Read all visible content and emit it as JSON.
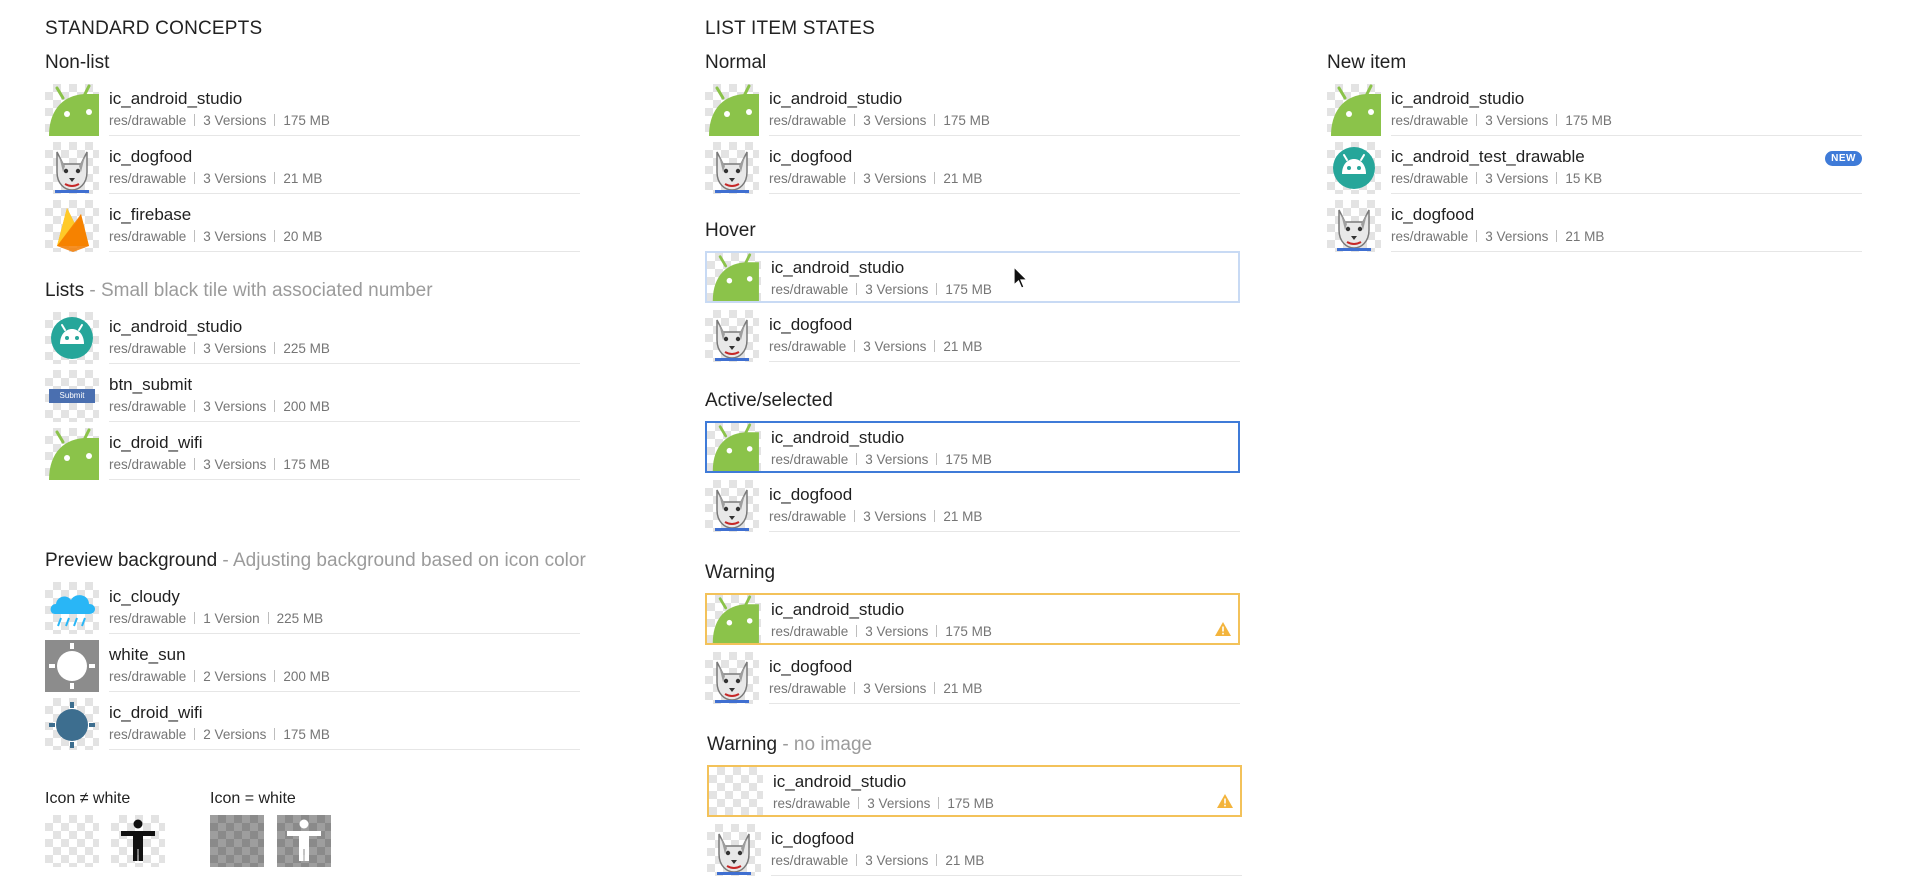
{
  "titles": {
    "standard": "STANDARD CONCEPTS",
    "list_states": "LIST ITEM STATES"
  },
  "sections": {
    "non_list": "Non-list",
    "lists": "Lists",
    "lists_sub": " - Small black tile with associated number",
    "preview": "Preview background",
    "preview_sub": " - Adjusting background based on icon color",
    "normal": "Normal",
    "hover": "Hover",
    "active": "Active/selected",
    "warning": "Warning",
    "warning_noimg": "Warning",
    "warning_noimg_sub": " - no image",
    "new_item": "New item",
    "icon_ne_white": "Icon ≠ white",
    "icon_eq_white": "Icon = white"
  },
  "rows": {
    "nl1": {
      "name": "ic_android_studio",
      "path": "res/drawable",
      "versions": "3 Versions",
      "size": "175 MB"
    },
    "nl2": {
      "name": "ic_dogfood",
      "path": "res/drawable",
      "versions": "3 Versions",
      "size": "21 MB"
    },
    "nl3": {
      "name": "ic_firebase",
      "path": "res/drawable",
      "versions": "3 Versions",
      "size": "20 MB"
    },
    "li1": {
      "name": "ic_android_studio",
      "path": "res/drawable",
      "versions": "3 Versions",
      "size": "225 MB"
    },
    "li2": {
      "name": "btn_submit",
      "path": "res/drawable",
      "versions": "3 Versions",
      "size": "200 MB",
      "thumb_text": "Submit"
    },
    "li3": {
      "name": "ic_droid_wifi",
      "path": "res/drawable",
      "versions": "3 Versions",
      "size": "175 MB"
    },
    "pb1": {
      "name": "ic_cloudy",
      "path": "res/drawable",
      "versions": "1 Version",
      "size": "225 MB"
    },
    "pb2": {
      "name": "white_sun",
      "path": "res/drawable",
      "versions": "2 Versions",
      "size": "200 MB"
    },
    "pb3": {
      "name": "ic_droid_wifi",
      "path": "res/drawable",
      "versions": "2 Versions",
      "size": "175 MB"
    },
    "n1": {
      "name": "ic_android_studio",
      "path": "res/drawable",
      "versions": "3 Versions",
      "size": "175 MB"
    },
    "n2": {
      "name": "ic_dogfood",
      "path": "res/drawable",
      "versions": "3 Versions",
      "size": "21 MB"
    },
    "h1": {
      "name": "ic_android_studio",
      "path": "res/drawable",
      "versions": "3 Versions",
      "size": "175 MB"
    },
    "h2": {
      "name": "ic_dogfood",
      "path": "res/drawable",
      "versions": "3 Versions",
      "size": "21 MB"
    },
    "a1": {
      "name": "ic_android_studio",
      "path": "res/drawable",
      "versions": "3 Versions",
      "size": "175 MB"
    },
    "a2": {
      "name": "ic_dogfood",
      "path": "res/drawable",
      "versions": "3 Versions",
      "size": "21 MB"
    },
    "w1": {
      "name": "ic_android_studio",
      "path": "res/drawable",
      "versions": "3 Versions",
      "size": "175 MB"
    },
    "w2": {
      "name": "ic_dogfood",
      "path": "res/drawable",
      "versions": "3 Versions",
      "size": "21 MB"
    },
    "wn1": {
      "name": "ic_android_studio",
      "path": "res/drawable",
      "versions": "3 Versions",
      "size": "175 MB"
    },
    "wn2": {
      "name": "ic_dogfood",
      "path": "res/drawable",
      "versions": "3 Versions",
      "size": "21 MB"
    },
    "ni1": {
      "name": "ic_android_studio",
      "path": "res/drawable",
      "versions": "3 Versions",
      "size": "175 MB"
    },
    "ni2": {
      "name": "ic_android_test_drawable",
      "path": "res/drawable",
      "versions": "3 Versions",
      "size": "15 KB",
      "badge": "NEW"
    },
    "ni3": {
      "name": "ic_dogfood",
      "path": "res/drawable",
      "versions": "3 Versions",
      "size": "21 MB"
    }
  },
  "colors": {
    "android_green": "#8bc34a",
    "teal": "#26a69a",
    "hover_border": "#c8daf4",
    "active_border": "#3f7bd8",
    "warning_border": "#f3c25a",
    "new_badge": "#3f7bd8"
  },
  "icons": {
    "android": "android-icon",
    "dog": "dogfood-icon",
    "firebase": "firebase-icon",
    "teal_android": "android-badge-icon",
    "cloud": "cloudy-icon",
    "sun": "white-sun-icon",
    "wifi": "droid-wifi-icon",
    "warning": "warning-icon",
    "accessibility": "accessibility-icon",
    "cursor": "mouse-cursor-icon"
  }
}
